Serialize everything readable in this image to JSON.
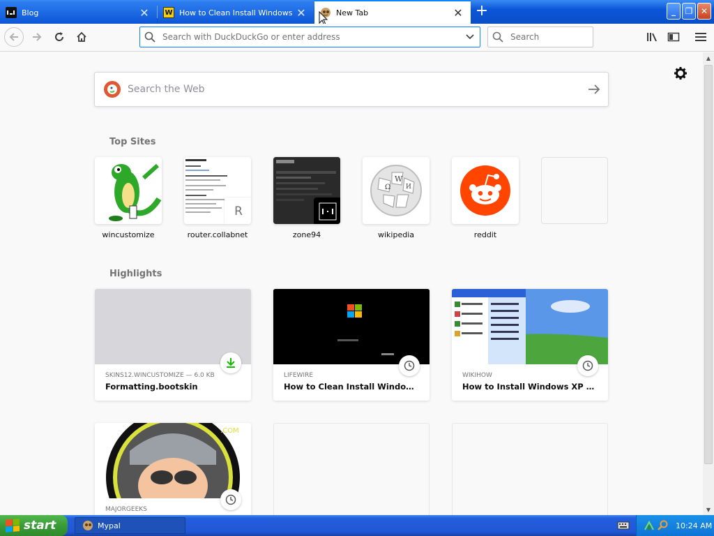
{
  "tabs": [
    {
      "title": "Blog",
      "favicon": "terminal-favicon",
      "active": false
    },
    {
      "title": "How to Clean Install Windows XP",
      "favicon": "w-favicon",
      "active": false
    },
    {
      "title": "New Tab",
      "favicon": "mypal-favicon",
      "active": true
    }
  ],
  "toolbar": {
    "url_placeholder": "Search with DuckDuckGo or enter address",
    "search_placeholder": "Search"
  },
  "newtab": {
    "web_search_placeholder": "Search the Web",
    "top_sites_title": "Top Sites",
    "top_sites": [
      {
        "label": "wincustomize"
      },
      {
        "label": "router.collabnet",
        "badge": "R"
      },
      {
        "label": "zone94"
      },
      {
        "label": "wikipedia"
      },
      {
        "label": "reddit"
      },
      {
        "label": ""
      }
    ],
    "highlights_title": "Highlights",
    "highlights": [
      {
        "source": "SKINS12.WINCUSTOMIZE — 6.0 KB",
        "title": "Formatting.bootskin",
        "badge": "download-icon"
      },
      {
        "source": "LIFEWIRE",
        "title": "How to Clean Install Windows XP",
        "badge": "history-icon"
      },
      {
        "source": "WIKIHOW",
        "title": "How to Install Windows XP (with...",
        "badge": "history-icon"
      },
      {
        "source": "MAJORGEEKS",
        "title": "",
        "badge": "history-icon"
      }
    ]
  },
  "taskbar": {
    "start_label": "start",
    "task_label": "Mypal",
    "clock": "10:24 AM"
  },
  "colors": {
    "accent": "#0a84ff",
    "reddit": "#ff4500",
    "download": "#12bc00",
    "ddg": "#de5833",
    "xp_taskbar": "#245edb",
    "xp_start": "#3b9b37"
  }
}
